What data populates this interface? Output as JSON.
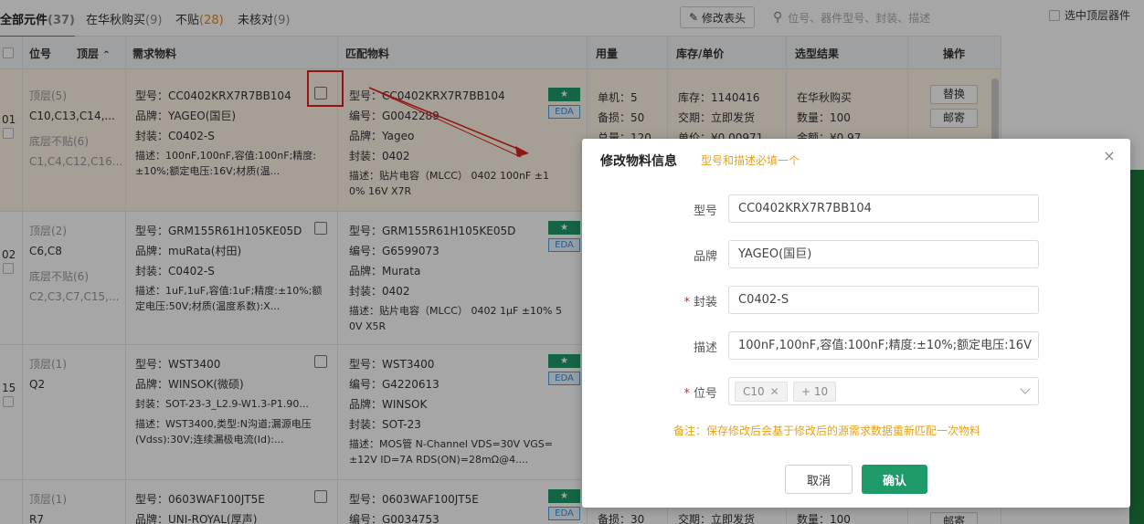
{
  "toolbar": {
    "tabs": [
      {
        "label": "全部元件",
        "count": "(37)"
      },
      {
        "label": "在华秋购买",
        "count": "(9)"
      },
      {
        "label": "不贴",
        "count": "(28)"
      },
      {
        "label": "未核对",
        "count": "(9)"
      }
    ],
    "edit_header_label": "修改表头",
    "search_placeholder": "位号、器件型号、封装、描述",
    "top_layer_checkbox": "选中顶层器件"
  },
  "table": {
    "headers": {
      "designator": "位号",
      "layer": "顶层",
      "required": "需求物料",
      "matched": "匹配物料",
      "usage": "用量",
      "stock": "库存/单价",
      "result": "选型结果",
      "actions": "操作"
    },
    "rows": [
      {
        "num": "01",
        "top": "顶层(5)",
        "top_refs": "C10,C13,C14,...",
        "no_mount": "底层不贴(6)",
        "no_mount_refs": "C1,C4,C12,C16...",
        "req_model": "型号：CC0402KRX7R7BB104",
        "req_brand": "品牌：YAGEO(国巨)",
        "req_pkg": "封装：C0402-S",
        "req_desc1": "描述：100nF,100nF,容值:100nF;精度:",
        "req_desc2": "±10%;额定电压:16V;材质(温...",
        "match_model": "型号：CC0402KRX7R7BB104",
        "match_code": "编号：G0042289",
        "match_brand": "品牌：Yageo",
        "match_pkg": "封装：0402",
        "match_desc1": "描述：贴片电容（MLCC） 0402 100nF ±1",
        "match_desc2": "0% 16V X7R",
        "usage1": "单机：5",
        "usage2": "备损：50",
        "usage3": "总量：120",
        "stock1": "库存：1140416",
        "stock2": "交期：立即发货",
        "stock3": "单价：¥0.00971",
        "result1": "在华秋购买",
        "result2": "数量：100",
        "result3": "金额：¥0.97",
        "op1": "替换",
        "op2": "邮寄"
      },
      {
        "num": "02",
        "top": "顶层(2)",
        "top_refs": "C6,C8",
        "no_mount": "底层不贴(6)",
        "no_mount_refs": "C2,C3,C7,C15,...",
        "req_model": "型号：GRM155R61H105KE05D",
        "req_brand": "品牌：muRata(村田)",
        "req_pkg": "封装：C0402-S",
        "req_desc1": "描述：1uF,1uF,容值:1uF;精度:±10%;额",
        "req_desc2": "定电压:50V;材质(温度系数):X...",
        "match_model": "型号：GRM155R61H105KE05D",
        "match_code": "编号：G6599073",
        "match_brand": "品牌：Murata",
        "match_pkg": "封装：0402",
        "match_desc1": "描述：贴片电容（MLCC） 0402 1μF ±10% 5",
        "match_desc2": "0V X5R"
      },
      {
        "num": "15",
        "top": "顶层(1)",
        "top_refs": "Q2",
        "req_model": "型号：WST3400",
        "req_brand": "品牌：WINSOK(微硕)",
        "req_pkg": "封装：SOT-23-3_L2.9-W1.3-P1.90...",
        "req_desc1": "描述：WST3400,类型:N沟道;漏源电压",
        "req_desc2": "(Vdss):30V;连续漏极电流(Id):...",
        "match_model": "型号：WST3400",
        "match_code": "编号：G4220613",
        "match_brand": "品牌：WINSOK",
        "match_pkg": "封装：SOT-23",
        "match_desc1": "描述：MOS管 N-Channel VDS=30V VGS=",
        "match_desc2": "±12V ID=7A RDS(ON)=28mΩ@4...."
      },
      {
        "num": "",
        "top": "顶层(1)",
        "top_refs": "R7",
        "req_model": "型号：0603WAF100JT5E",
        "req_brand": "品牌：UNI-ROYAL(厚声)",
        "match_model": "型号：0603WAF100JT5E",
        "match_code": "编号：G0034753",
        "usage2": "备损：30",
        "stock2": "交期：立即发货",
        "result2": "数量：100",
        "op2": "邮寄"
      }
    ],
    "tag_eda": "EDA",
    "tag_star": "★"
  },
  "modal": {
    "title": "修改物料信息",
    "hint": "型号和描述必填一个",
    "close": "×",
    "labels": {
      "model": "型号",
      "brand": "品牌",
      "package": "封装",
      "description": "描述",
      "designator": "位号"
    },
    "values": {
      "model": "CC0402KRX7R7BB104",
      "brand": "YAGEO(国巨)",
      "package": "C0402-S",
      "description": "100nF,100nF,容值:100nF;精度:±10%;额定电压:16V"
    },
    "designator_chip": "C10",
    "designator_more": "+ 10",
    "note": "备注：保存修改后会基于修改后的源需求数据重新匹配一次物料",
    "cancel": "取消",
    "confirm": "确认"
  },
  "colors": {
    "accent": "#1f9b6a",
    "warning": "#e6a21e",
    "required": "#e02020",
    "highlight_row": "#fdf5e6"
  }
}
